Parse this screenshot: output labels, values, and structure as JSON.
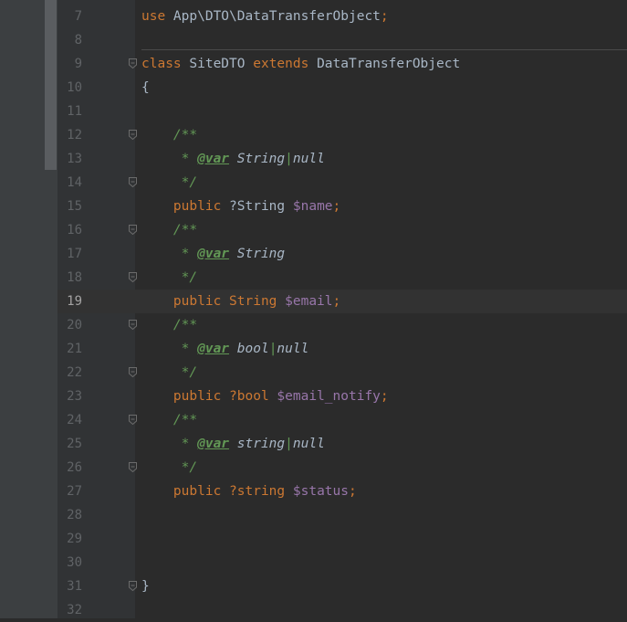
{
  "editor": {
    "lines": [
      {
        "num": "7",
        "tokens": [
          {
            "t": "use",
            "c": "kw"
          },
          {
            "t": " App\\DTO\\DataTransferObject",
            "c": "id"
          },
          {
            "t": ";",
            "c": "kw"
          }
        ],
        "fold": false
      },
      {
        "num": "8",
        "tokens": [],
        "fold": false
      },
      {
        "num": "9",
        "tokens": [
          {
            "t": "class",
            "c": "kw"
          },
          {
            "t": " SiteDTO ",
            "c": "id"
          },
          {
            "t": "extends",
            "c": "kw"
          },
          {
            "t": " DataTransferObject",
            "c": "id"
          }
        ],
        "fold": true
      },
      {
        "num": "10",
        "tokens": [
          {
            "t": "{",
            "c": "id"
          }
        ],
        "fold": false
      },
      {
        "num": "11",
        "tokens": [],
        "fold": false
      },
      {
        "num": "12",
        "tokens": [
          {
            "t": "    /**",
            "c": "cm"
          }
        ],
        "fold": true
      },
      {
        "num": "13",
        "tokens": [
          {
            "t": "     * ",
            "c": "cm"
          },
          {
            "t": "@var",
            "c": "tag"
          },
          {
            "t": " String",
            "c": "ty"
          },
          {
            "t": "|",
            "c": "pipe"
          },
          {
            "t": "null",
            "c": "ty"
          }
        ],
        "fold": false
      },
      {
        "num": "14",
        "tokens": [
          {
            "t": "     */",
            "c": "cm"
          }
        ],
        "fold": true
      },
      {
        "num": "15",
        "tokens": [
          {
            "t": "    public ",
            "c": "kw"
          },
          {
            "t": "?String ",
            "c": "id"
          },
          {
            "t": "$name",
            "c": "var"
          },
          {
            "t": ";",
            "c": "kw"
          }
        ],
        "fold": false
      },
      {
        "num": "16",
        "tokens": [
          {
            "t": "    /**",
            "c": "cm"
          }
        ],
        "fold": true
      },
      {
        "num": "17",
        "tokens": [
          {
            "t": "     * ",
            "c": "cm"
          },
          {
            "t": "@var",
            "c": "tag"
          },
          {
            "t": " String",
            "c": "ty"
          }
        ],
        "fold": false
      },
      {
        "num": "18",
        "tokens": [
          {
            "t": "     */",
            "c": "cm"
          }
        ],
        "fold": true
      },
      {
        "num": "19",
        "tokens": [
          {
            "t": "    public ",
            "c": "kw"
          },
          {
            "t": "String ",
            "c": "kw"
          },
          {
            "t": "$email",
            "c": "var"
          },
          {
            "t": ";",
            "c": "kw"
          }
        ],
        "fold": false,
        "current": true
      },
      {
        "num": "20",
        "tokens": [
          {
            "t": "    /**",
            "c": "cm"
          }
        ],
        "fold": true
      },
      {
        "num": "21",
        "tokens": [
          {
            "t": "     * ",
            "c": "cm"
          },
          {
            "t": "@var",
            "c": "tag"
          },
          {
            "t": " bool",
            "c": "ty"
          },
          {
            "t": "|",
            "c": "pipe"
          },
          {
            "t": "null",
            "c": "ty"
          }
        ],
        "fold": false
      },
      {
        "num": "22",
        "tokens": [
          {
            "t": "     */",
            "c": "cm"
          }
        ],
        "fold": true
      },
      {
        "num": "23",
        "tokens": [
          {
            "t": "    public ",
            "c": "kw"
          },
          {
            "t": "?bool ",
            "c": "kw"
          },
          {
            "t": "$email_notify",
            "c": "var"
          },
          {
            "t": ";",
            "c": "kw"
          }
        ],
        "fold": false
      },
      {
        "num": "24",
        "tokens": [
          {
            "t": "    /**",
            "c": "cm"
          }
        ],
        "fold": true
      },
      {
        "num": "25",
        "tokens": [
          {
            "t": "     * ",
            "c": "cm"
          },
          {
            "t": "@var",
            "c": "tag"
          },
          {
            "t": " string",
            "c": "ty"
          },
          {
            "t": "|",
            "c": "pipe"
          },
          {
            "t": "null",
            "c": "ty"
          }
        ],
        "fold": false
      },
      {
        "num": "26",
        "tokens": [
          {
            "t": "     */",
            "c": "cm"
          }
        ],
        "fold": true
      },
      {
        "num": "27",
        "tokens": [
          {
            "t": "    public ",
            "c": "kw"
          },
          {
            "t": "?string ",
            "c": "kw"
          },
          {
            "t": "$status",
            "c": "var"
          },
          {
            "t": ";",
            "c": "kw"
          }
        ],
        "fold": false
      },
      {
        "num": "28",
        "tokens": [],
        "fold": false
      },
      {
        "num": "29",
        "tokens": [],
        "fold": false
      },
      {
        "num": "30",
        "tokens": [],
        "fold": false
      },
      {
        "num": "31",
        "tokens": [
          {
            "t": "}",
            "c": "id"
          }
        ],
        "fold": true
      },
      {
        "num": "32",
        "tokens": [],
        "fold": false
      }
    ]
  },
  "colors": {
    "keyword": "#cc7832",
    "comment": "#629755",
    "variable": "#9876aa",
    "text": "#a9b7c6",
    "background": "#2b2b2b",
    "gutter": "#313335"
  },
  "icons": {
    "fold_marker": "fold-marker-icon"
  }
}
